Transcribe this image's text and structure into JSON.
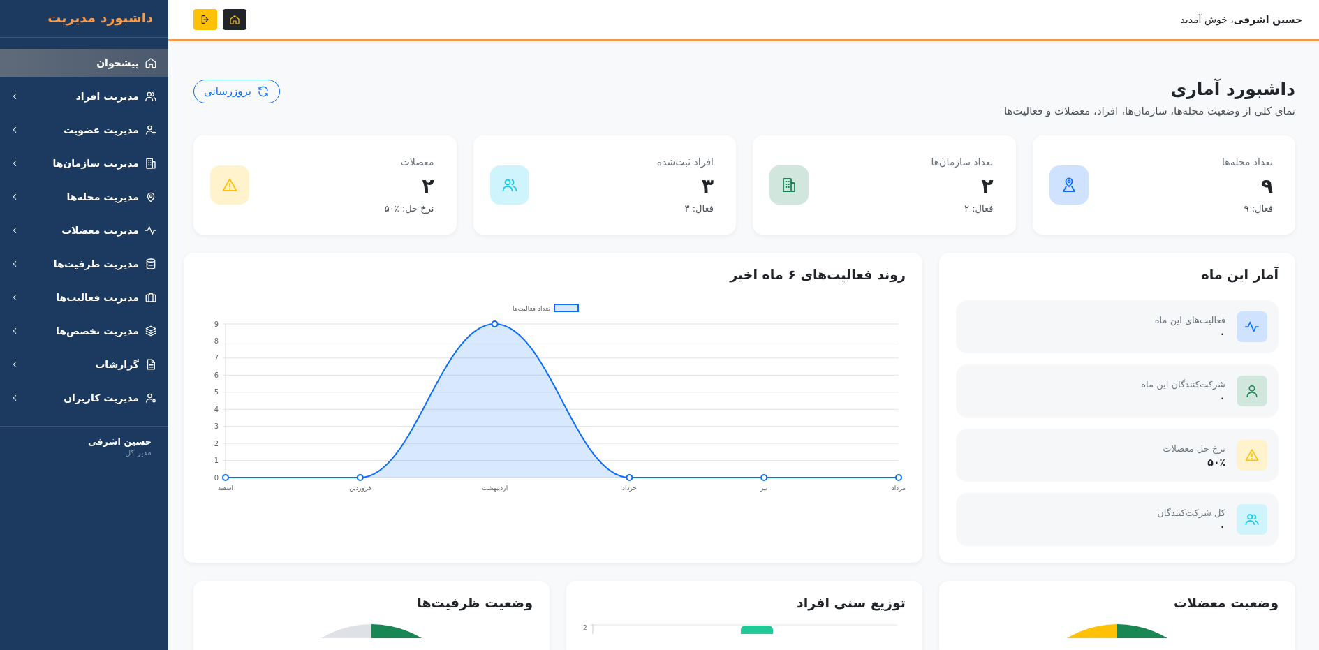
{
  "sidebar": {
    "title": "داشبورد مدیریت",
    "items": [
      {
        "label": "پیشخوان",
        "selected": true,
        "expandable": false
      },
      {
        "label": "مدیریت افراد",
        "selected": false,
        "expandable": true
      },
      {
        "label": "مدیریت عضویت",
        "selected": false,
        "expandable": true
      },
      {
        "label": "مدیریت سازمان‌ها",
        "selected": false,
        "expandable": true
      },
      {
        "label": "مدیریت محله‌ها",
        "selected": false,
        "expandable": true
      },
      {
        "label": "مدیریت معضلات",
        "selected": false,
        "expandable": true
      },
      {
        "label": "مدیریت ظرفیت‌ها",
        "selected": false,
        "expandable": true
      },
      {
        "label": "مدیریت فعالیت‌ها",
        "selected": false,
        "expandable": true
      },
      {
        "label": "مدیریت تخصص‌ها",
        "selected": false,
        "expandable": true
      },
      {
        "label": "گزارشات",
        "selected": false,
        "expandable": true
      },
      {
        "label": "مدیریت کاربران",
        "selected": false,
        "expandable": true
      }
    ],
    "user": {
      "name": "حسین اشرفی",
      "role": "مدیر کل"
    }
  },
  "header": {
    "welcome": "**حسین اشرفی**، خوش آمدید"
  },
  "page": {
    "title": "داشبورد آماری",
    "subtitle": "نمای کلی از وضعیت محله‌ها، سازمان‌ها، افراد، معضلات و فعالیت‌ها",
    "refresh_button": "بروزرسانی"
  },
  "stat_cards": [
    {
      "label": "تعداد محله‌ها",
      "value": "۹",
      "detail": "فعال: ۹",
      "color": "#0d6efd"
    },
    {
      "label": "تعداد سازمان‌ها",
      "value": "۲",
      "detail": "فعال: ۲",
      "color": "#198754"
    },
    {
      "label": "افراد ثبت‌شده",
      "value": "۳",
      "detail": "فعال: ۳",
      "color": "#0dcaf0"
    },
    {
      "label": "معضلات",
      "value": "۲",
      "detail": "نرخ حل: ٪۵۰",
      "color": "#ffc107"
    }
  ],
  "monthly_stats": {
    "title": "آمار این ماه",
    "items": [
      {
        "label": "فعالیت‌های این ماه",
        "value": "۰",
        "color": "#0d6efd"
      },
      {
        "label": "شرکت‌کنندگان این ماه",
        "value": "۰",
        "color": "#198754"
      },
      {
        "label": "نرخ حل معضلات",
        "value": "۵۰٪",
        "color": "#ffc107"
      },
      {
        "label": "کل شرکت‌کنندگان",
        "value": "۰",
        "color": "#0dcaf0"
      }
    ]
  },
  "activity_chart": {
    "title": "روند فعالیت‌های ۶ ماه اخیر",
    "chart_data": {
      "type": "area",
      "categories": [
        "اسفند",
        "فروردین",
        "اردیبهشت",
        "خرداد",
        "تیر",
        "مرداد"
      ],
      "series": [
        {
          "name": "تعداد فعالیت‌ها",
          "color": "#0d6efd",
          "values": [
            0,
            0,
            9,
            0,
            0,
            0
          ]
        }
      ],
      "ylim": [
        0,
        9
      ],
      "grid": true,
      "yticks": [
        0,
        1,
        2,
        3,
        4,
        5,
        6,
        7,
        8,
        9
      ]
    }
  },
  "bottom_cards": [
    {
      "title": "وضعیت معضلات",
      "kind": "pie"
    },
    {
      "title": "توزیع سنی افراد",
      "kind": "bar",
      "axis_label": "2"
    },
    {
      "title": "وضعیت ظرفیت‌ها",
      "kind": "pie"
    }
  ]
}
